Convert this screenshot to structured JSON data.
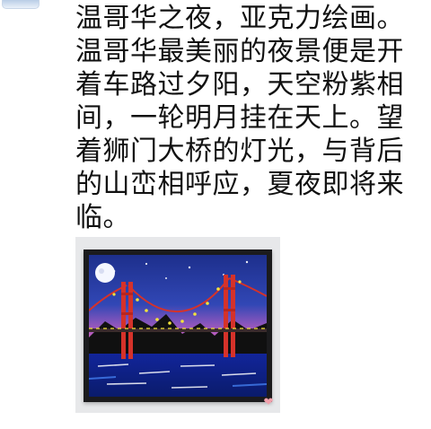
{
  "post": {
    "lines": [
      "温哥华之夜，亚克力绘画。",
      "温哥华最美丽的夜景便是开",
      "着车路过夕阳，天空粉紫相",
      "间，一轮明月挂在天上。望",
      "着狮门大桥的灯光，与背后",
      "的山峦相呼应，夏夜即将来",
      "临。"
    ]
  },
  "image": {
    "subject": "acrylic painting of a suspension bridge at night",
    "colors": {
      "sky_top": "#1d2f8c",
      "sky_pink": "#ff6fa3",
      "bridge": "#d5322a",
      "water": "#0e2f9a",
      "mountain": "#101010",
      "lights": "#f3e33b"
    }
  },
  "icons": {
    "watermark": "heart-icon"
  }
}
